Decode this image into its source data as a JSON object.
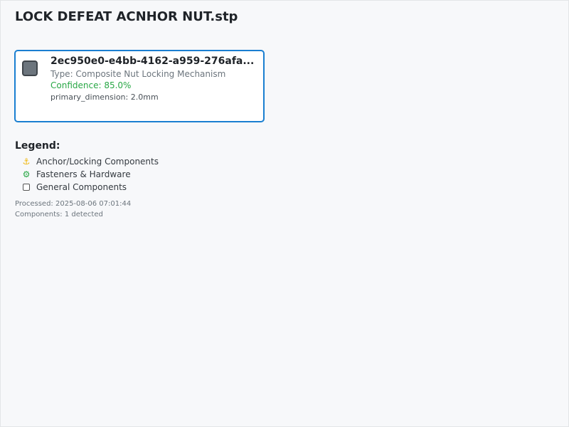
{
  "page": {
    "title": "LOCK DEFEAT ACNHOR NUT.stp"
  },
  "component": {
    "id": "2ec950e0-e4bb-4162-a959-276afa...",
    "type_label": "Type: Composite Nut Locking Mechanism",
    "confidence_label": "Confidence: 85.0%",
    "dimension_label": "primary_dimension: 2.0mm",
    "icon": "component-square-icon",
    "icon_color": "#6c757d",
    "border_color": "#1a7fd1",
    "confidence_color": "#28a745"
  },
  "legend": {
    "title": "Legend:",
    "items": [
      {
        "icon": "anchor-icon",
        "glyph": "⚓",
        "label": "Anchor/Locking Components",
        "color": "#f0b400"
      },
      {
        "icon": "gear-icon",
        "glyph": "⚙",
        "label": "Fasteners & Hardware",
        "color": "#28a745"
      },
      {
        "icon": "square-icon",
        "glyph": "",
        "label": "General Components",
        "color": "#555555"
      }
    ]
  },
  "footer": {
    "processed": "Processed: 2025-08-06 07:01:44",
    "components": "Components: 1 detected"
  }
}
